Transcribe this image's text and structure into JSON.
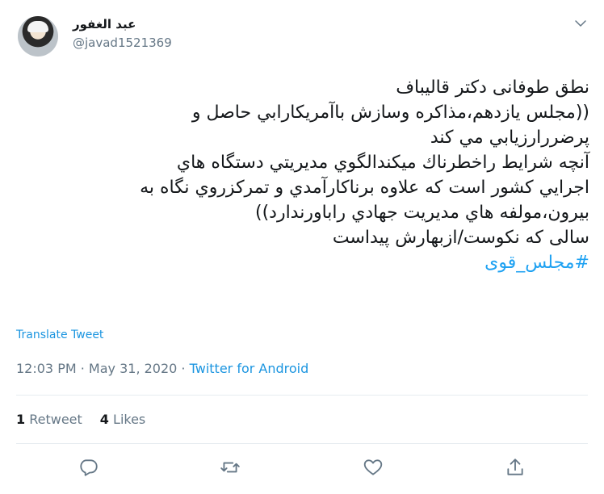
{
  "author": {
    "display_name": "عبد الغفور",
    "handle": "@javad1521369"
  },
  "tweet": {
    "lines": [
      "نطق طوفانی دکتر قالیباف",
      "((مجلس یازدهم،مذاکره وسازش باآمریکارابي حاصل و",
      "پرضررارزيابي مي کند",
      "آنچه شرايط راخطرناك ميکندالگوي مديريتي دستگاه هاي",
      "اجرايي کشور است که علاوه برناکارآمدي و تمرکزروي نگاه به",
      "بيرون،مولفه هاي مديريت جهادي راباورندارد))",
      "سالی که نکوست/ازبهارش پیداست"
    ],
    "hashtag": "#مجلس_قوی"
  },
  "translate_label": "Translate Tweet",
  "meta": {
    "time": "12:03 PM",
    "separator": " · ",
    "date": "May 31, 2020",
    "source": "Twitter for Android"
  },
  "stats": {
    "retweets_count": "1",
    "retweets_label": "Retweet",
    "likes_count": "4",
    "likes_label": "Likes"
  },
  "colors": {
    "accent": "#1da1f2",
    "link": "#1b95e0",
    "muted": "#657786",
    "text": "#14171a",
    "divider": "#e6ecf0"
  },
  "icons": [
    "chevron-down-icon",
    "reply-icon",
    "retweet-icon",
    "like-icon",
    "share-icon"
  ]
}
